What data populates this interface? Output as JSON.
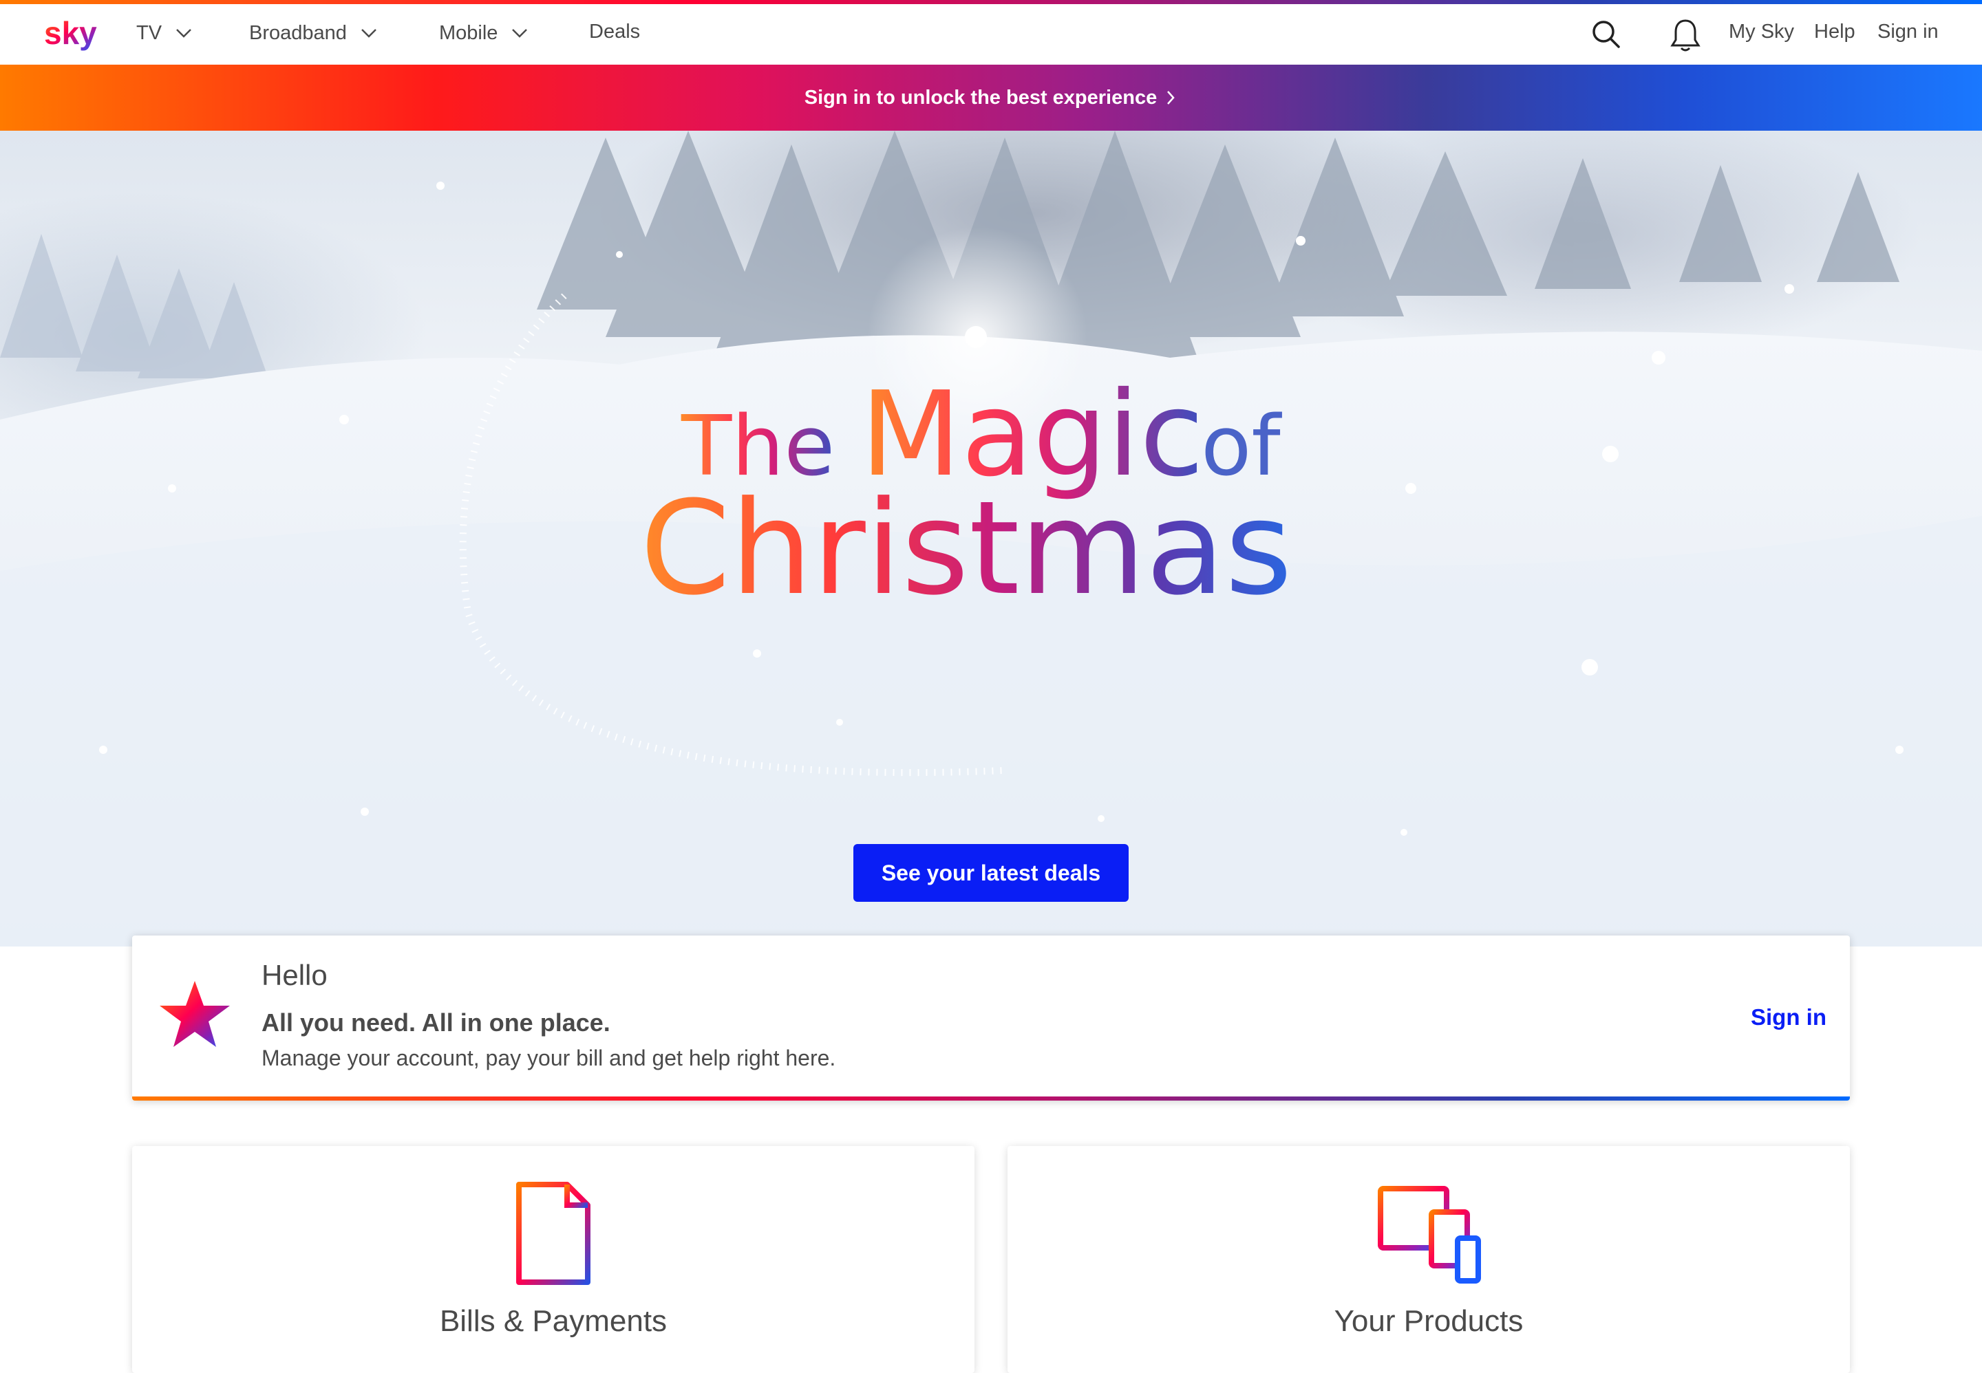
{
  "nav": {
    "logo": "sky",
    "items": [
      {
        "label": "TV"
      },
      {
        "label": "Broadband"
      },
      {
        "label": "Mobile"
      },
      {
        "label": "Deals"
      }
    ],
    "right": {
      "my_sky": "My Sky",
      "help": "Help",
      "sign_in": "Sign in"
    }
  },
  "banner": {
    "text": "Sign in to unlock the best experience"
  },
  "hero": {
    "title_line1_a": "The",
    "title_line1_b": "Magic",
    "title_line1_c": "of",
    "title_line2": "Christmas",
    "cta": "See your latest deals"
  },
  "hello": {
    "title": "Hello",
    "subtitle": "All you need. All in one place.",
    "body": "Manage your account, pay your bill and get help right here.",
    "sign_in": "Sign in"
  },
  "cards": [
    {
      "label": "Bills & Payments",
      "icon": "bill-document-icon"
    },
    {
      "label": "Your Products",
      "icon": "devices-icon"
    }
  ],
  "colors": {
    "accent": "#0a1ef5",
    "text": "#4a4a4a"
  }
}
